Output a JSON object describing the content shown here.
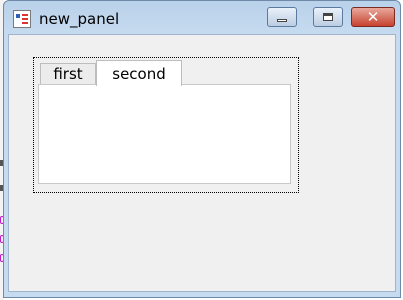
{
  "window": {
    "title": "new_panel",
    "controls": {
      "minimize": "minimize",
      "maximize": "maximize",
      "close": "✕"
    }
  },
  "tabs": [
    {
      "label": "first",
      "selected": false
    },
    {
      "label": "second",
      "selected": true
    }
  ],
  "colors": {
    "close_button": "#c6422e",
    "titlebar": "#b9d1ea",
    "client": "#f0f0f0"
  },
  "icons": {
    "app": "app-icon",
    "minimize": "minimize-icon",
    "maximize": "maximize-icon",
    "close": "close-icon"
  }
}
